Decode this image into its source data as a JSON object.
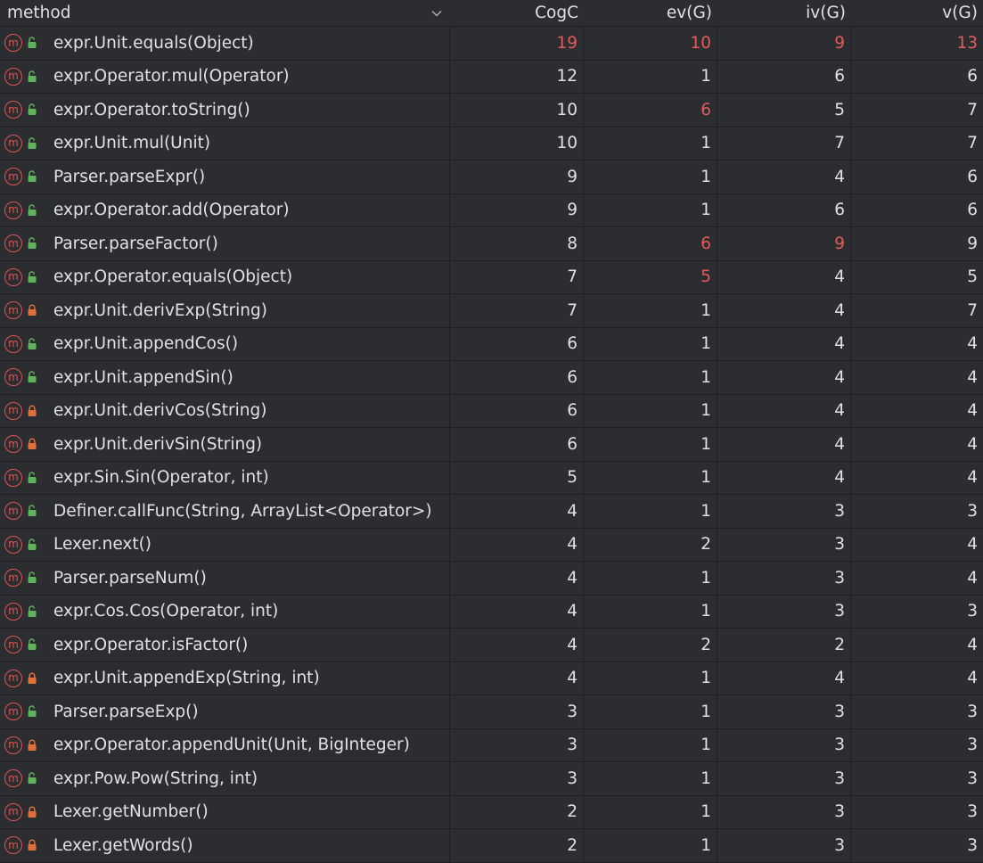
{
  "colors": {
    "background": "#2b2d30",
    "grid": "#1e1f22",
    "text": "#dfe1e5",
    "highlight": "#e55b5b",
    "method_icon": "#e05555",
    "public_lock": "#5fb35a",
    "private_lock": "#e0703a"
  },
  "columns": {
    "method": "method",
    "cogc": "CogC",
    "ev": "ev(G)",
    "iv": "iv(G)",
    "v": "v(G)",
    "sort_icon": "chevron-down-icon"
  },
  "rows": [
    {
      "method": "expr.Unit.equals(Object)",
      "access": "public",
      "cogc": "19",
      "ev": "10",
      "iv": "9",
      "v": "13",
      "hot": {
        "cogc": true,
        "ev": true,
        "iv": true,
        "v": true
      }
    },
    {
      "method": "expr.Operator.mul(Operator)",
      "access": "public",
      "cogc": "12",
      "ev": "1",
      "iv": "6",
      "v": "6",
      "hot": {}
    },
    {
      "method": "expr.Operator.toString()",
      "access": "public",
      "cogc": "10",
      "ev": "6",
      "iv": "5",
      "v": "7",
      "hot": {
        "ev": true
      }
    },
    {
      "method": "expr.Unit.mul(Unit)",
      "access": "public",
      "cogc": "10",
      "ev": "1",
      "iv": "7",
      "v": "7",
      "hot": {}
    },
    {
      "method": "Parser.parseExpr()",
      "access": "public",
      "cogc": "9",
      "ev": "1",
      "iv": "4",
      "v": "6",
      "hot": {}
    },
    {
      "method": "expr.Operator.add(Operator)",
      "access": "public",
      "cogc": "9",
      "ev": "1",
      "iv": "6",
      "v": "6",
      "hot": {}
    },
    {
      "method": "Parser.parseFactor()",
      "access": "public",
      "cogc": "8",
      "ev": "6",
      "iv": "9",
      "v": "9",
      "hot": {
        "ev": true,
        "iv": true
      }
    },
    {
      "method": "expr.Operator.equals(Object)",
      "access": "public",
      "cogc": "7",
      "ev": "5",
      "iv": "4",
      "v": "5",
      "hot": {
        "ev": true
      }
    },
    {
      "method": "expr.Unit.derivExp(String)",
      "access": "private",
      "cogc": "7",
      "ev": "1",
      "iv": "4",
      "v": "7",
      "hot": {}
    },
    {
      "method": "expr.Unit.appendCos()",
      "access": "public",
      "cogc": "6",
      "ev": "1",
      "iv": "4",
      "v": "4",
      "hot": {}
    },
    {
      "method": "expr.Unit.appendSin()",
      "access": "public",
      "cogc": "6",
      "ev": "1",
      "iv": "4",
      "v": "4",
      "hot": {}
    },
    {
      "method": "expr.Unit.derivCos(String)",
      "access": "private",
      "cogc": "6",
      "ev": "1",
      "iv": "4",
      "v": "4",
      "hot": {}
    },
    {
      "method": "expr.Unit.derivSin(String)",
      "access": "private",
      "cogc": "6",
      "ev": "1",
      "iv": "4",
      "v": "4",
      "hot": {}
    },
    {
      "method": "expr.Sin.Sin(Operator, int)",
      "access": "public",
      "cogc": "5",
      "ev": "1",
      "iv": "4",
      "v": "4",
      "hot": {}
    },
    {
      "method": "Definer.callFunc(String, ArrayList<Operator>)",
      "access": "public",
      "cogc": "4",
      "ev": "1",
      "iv": "3",
      "v": "3",
      "hot": {}
    },
    {
      "method": "Lexer.next()",
      "access": "public",
      "cogc": "4",
      "ev": "2",
      "iv": "3",
      "v": "4",
      "hot": {}
    },
    {
      "method": "Parser.parseNum()",
      "access": "public",
      "cogc": "4",
      "ev": "1",
      "iv": "3",
      "v": "4",
      "hot": {}
    },
    {
      "method": "expr.Cos.Cos(Operator, int)",
      "access": "public",
      "cogc": "4",
      "ev": "1",
      "iv": "3",
      "v": "3",
      "hot": {}
    },
    {
      "method": "expr.Operator.isFactor()",
      "access": "public",
      "cogc": "4",
      "ev": "2",
      "iv": "2",
      "v": "4",
      "hot": {}
    },
    {
      "method": "expr.Unit.appendExp(String, int)",
      "access": "private",
      "cogc": "4",
      "ev": "1",
      "iv": "4",
      "v": "4",
      "hot": {}
    },
    {
      "method": "Parser.parseExp()",
      "access": "public",
      "cogc": "3",
      "ev": "1",
      "iv": "3",
      "v": "3",
      "hot": {}
    },
    {
      "method": "expr.Operator.appendUnit(Unit, BigInteger)",
      "access": "private",
      "cogc": "3",
      "ev": "1",
      "iv": "3",
      "v": "3",
      "hot": {}
    },
    {
      "method": "expr.Pow.Pow(String, int)",
      "access": "public",
      "cogc": "3",
      "ev": "1",
      "iv": "3",
      "v": "3",
      "hot": {}
    },
    {
      "method": "Lexer.getNumber()",
      "access": "private",
      "cogc": "2",
      "ev": "1",
      "iv": "3",
      "v": "3",
      "hot": {}
    },
    {
      "method": "Lexer.getWords()",
      "access": "private",
      "cogc": "2",
      "ev": "1",
      "iv": "3",
      "v": "3",
      "hot": {}
    }
  ]
}
